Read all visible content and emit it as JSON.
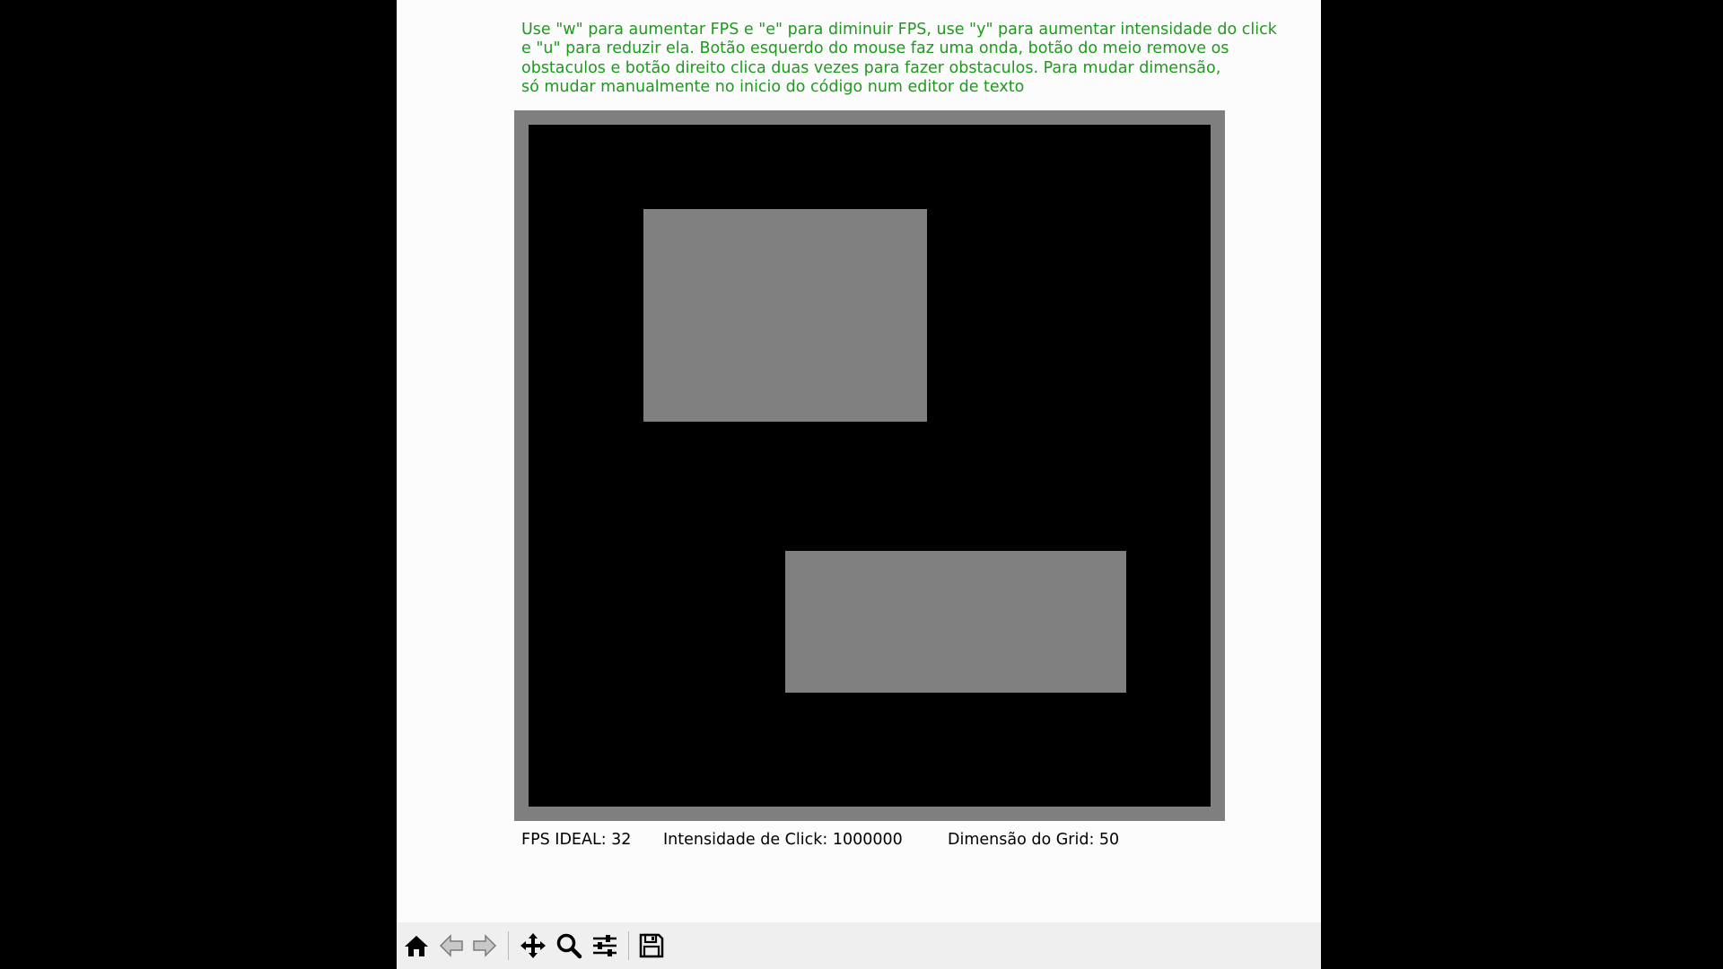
{
  "instructions": {
    "text": "Use \"w\" para aumentar FPS e \"e\" para diminuir FPS, use \"y\" para aumentar intensidade do click\ne \"u\" para reduzir ela. Botão esquerdo do mouse faz uma onda, botão do meio remove os\nobstaculos e botão direito clica duas vezes para fazer obstaculos. Para mudar dimensão,\nsó mudar manualmente no inicio do código num editor de texto",
    "color": "#1f9a1f"
  },
  "simulation": {
    "background_color": "#000000",
    "border_color": "#7f7f7f",
    "obstacle_color": "#808080"
  },
  "status": {
    "fps": "FPS IDEAL: 32",
    "click_intensity": "Intensidade de Click: 1000000",
    "grid_dimension": "Dimensão do Grid: 50"
  },
  "toolbar": {
    "buttons": [
      {
        "name": "home-button",
        "icon": "home-icon"
      },
      {
        "name": "back-button",
        "icon": "arrow-left-icon"
      },
      {
        "name": "forward-button",
        "icon": "arrow-right-icon"
      },
      {
        "name": "pan-button",
        "icon": "move-icon"
      },
      {
        "name": "zoom-button",
        "icon": "magnifier-icon"
      },
      {
        "name": "configure-subplots-button",
        "icon": "sliders-icon"
      },
      {
        "name": "save-button",
        "icon": "floppy-disk-icon"
      }
    ]
  }
}
